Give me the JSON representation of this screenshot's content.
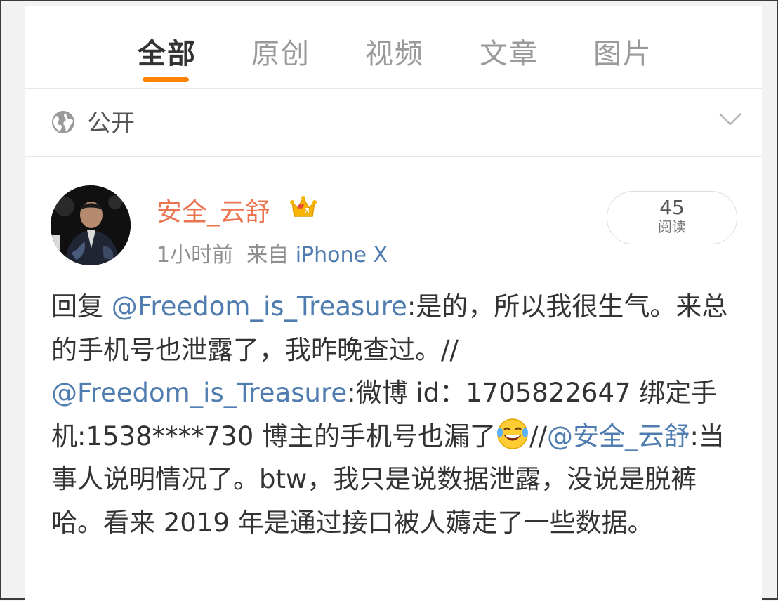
{
  "tabs": [
    {
      "label": "全部",
      "active": true
    },
    {
      "label": "原创",
      "active": false
    },
    {
      "label": "视频",
      "active": false
    },
    {
      "label": "文章",
      "active": false
    },
    {
      "label": "图片",
      "active": false
    }
  ],
  "visibility": {
    "label": "公开"
  },
  "post": {
    "username": "安全_云舒",
    "time": "1小时前",
    "source_prefix": "来自",
    "source": "iPhone X",
    "reads": {
      "count": "45",
      "label": "阅读"
    },
    "text": {
      "s1": "回复",
      "m1": "@Freedom_is_Treasure",
      "s2": ":是的，所以我很生气。来总的手机号也泄露了，我昨晚查过。//",
      "m2": "@Freedom_is_Treasure",
      "s3": ":微博 id：1705822647 绑定手机:1538****730 博主的手机号也漏了",
      "emoji": "laugh-cry-emoji",
      "s4": "//",
      "m3": "@安全_云舒",
      "s5": ":当事人说明情况了。btw，我只是说数据泄露，没说是脱裤哈。看来 2019 年是通过接口被人薅走了一些数据。"
    }
  },
  "colors": {
    "accent": "#ff8200",
    "username": "#eb7350",
    "link": "#507daf",
    "text": "#333333",
    "muted": "#8f8f8f"
  }
}
